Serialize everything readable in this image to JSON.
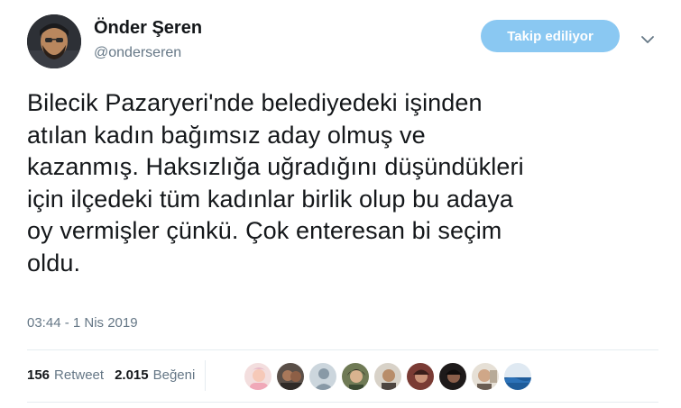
{
  "author": {
    "name": "Önder Şeren",
    "handle": "@onderseren"
  },
  "follow_button": {
    "label": "Takip ediliyor"
  },
  "menu_icon": "chevron-down-icon",
  "tweet": {
    "lines": [
      "Bilecik Pazaryeri'nde belediyedeki işinden",
      "atılan kadın bağımsız aday olmuş ve",
      "kazanmış. Haksızlığa uğradığını düşündükleri",
      "için ilçedeki tüm kadınlar birlik olup bu adaya",
      "oy vermişler çünkü. Çok enteresan bi seçim",
      "oldu."
    ],
    "timestamp": "03:44 - 1 Nis 2019"
  },
  "stats": {
    "retweets_count": "156",
    "retweets_label": "Retweet",
    "likes_count": "2.015",
    "likes_label": "Beğeni"
  },
  "likers_count": 9,
  "colors": {
    "accent": "#8ac8f2",
    "text": "#14171a",
    "muted": "#657786",
    "divider": "#e6ecf0"
  }
}
